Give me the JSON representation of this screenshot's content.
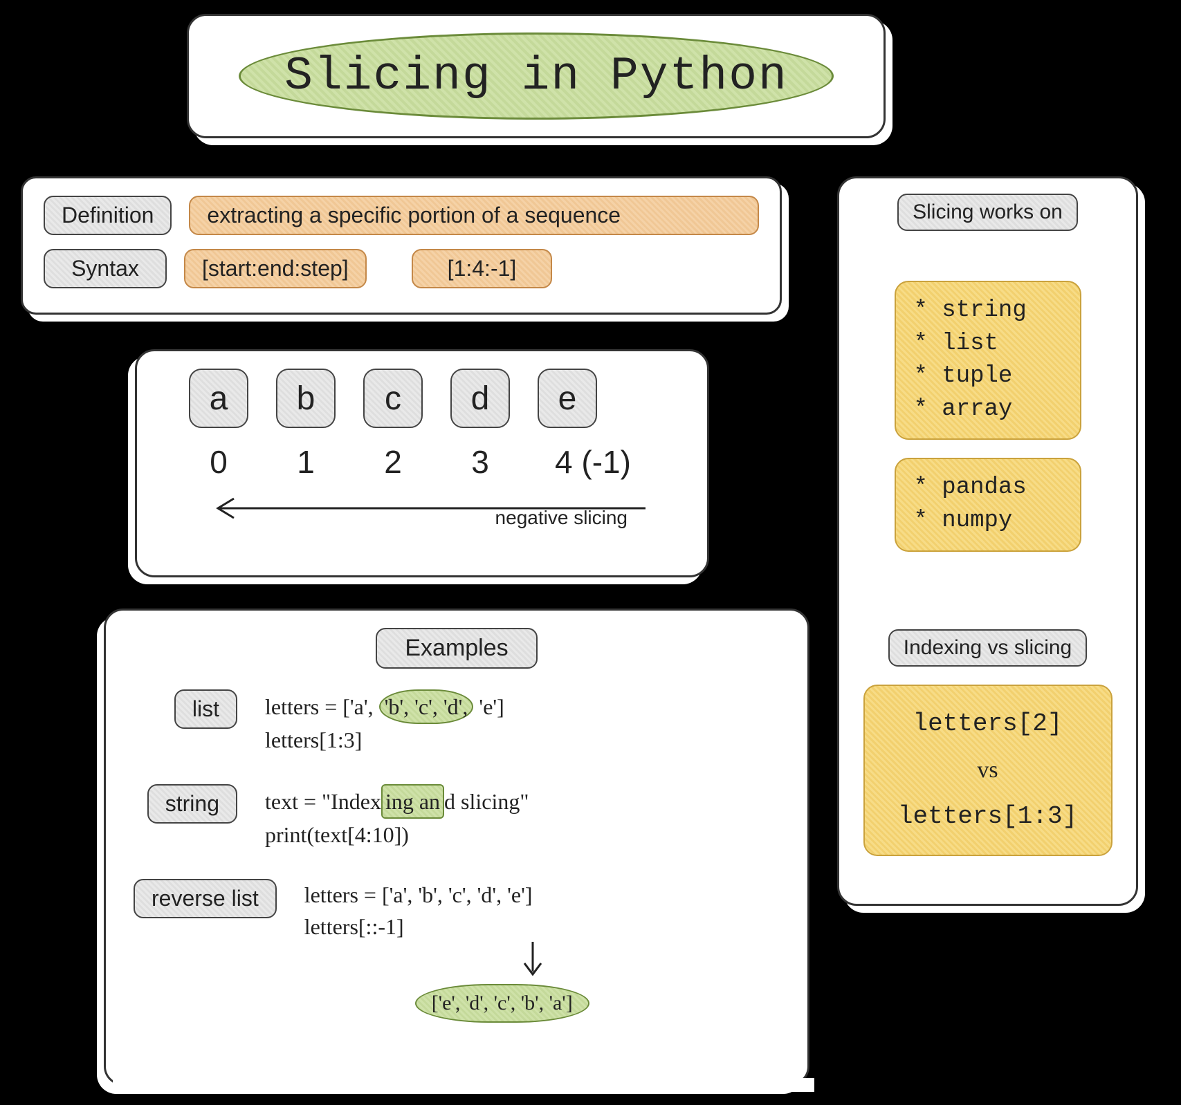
{
  "title": "Slicing in Python",
  "definition": {
    "label_def": "Definition",
    "text_def": "extracting a specific portion of a sequence",
    "label_syntax": "Syntax",
    "syntax1": "[start:end:step]",
    "syntax2": "[1:4:-1]"
  },
  "sequence": {
    "letters": [
      "a",
      "b",
      "c",
      "d",
      "e"
    ],
    "indices": [
      "0",
      "1",
      "2",
      "3",
      "4 (-1)"
    ],
    "neg_label": "negative slicing"
  },
  "examples": {
    "header": "Examples",
    "list": {
      "label": "list",
      "line1_pre": "letters = ['a', ",
      "line1_hl": "'b', 'c', 'd',",
      "line1_post": " 'e']",
      "line2": "letters[1:3]"
    },
    "string": {
      "label": "string",
      "line1_pre": "text = \"Index",
      "line1_hl": "ing an",
      "line1_post": "d slicing\"",
      "line2": "print(text[4:10])"
    },
    "reverse": {
      "label": "reverse list",
      "line1": "letters = ['a', 'b', 'c', 'd', 'e']",
      "line2": "letters[::-1]",
      "result": "['e', 'd', 'c', 'b', 'a']"
    }
  },
  "right": {
    "works_on_label": "Slicing works on",
    "group1": [
      "* string",
      "* list",
      "* tuple",
      "* array"
    ],
    "group2": [
      "* pandas",
      "* numpy"
    ],
    "ivs_label": "Indexing vs slicing",
    "ivs_a": "letters[2]",
    "ivs_vs": "vs",
    "ivs_b": "letters[1:3]"
  }
}
